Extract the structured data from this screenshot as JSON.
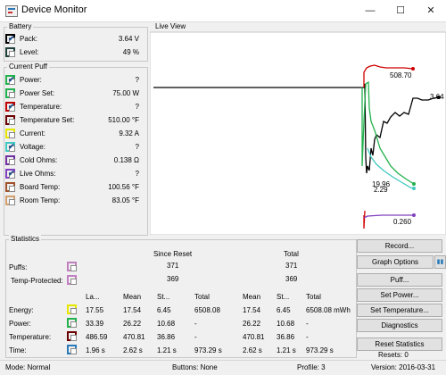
{
  "window": {
    "title": "Device Monitor",
    "minimize": "—",
    "maximize": "☐",
    "close": "✕"
  },
  "battery": {
    "group_label": "Battery",
    "rows": [
      {
        "label": "Pack:",
        "value": "3.64 V",
        "color": "#000000",
        "checked": true
      },
      {
        "label": "Level:",
        "value": "49 %",
        "color": "#1f3f3a",
        "checked": false
      }
    ]
  },
  "current_puff": {
    "group_label": "Current Puff",
    "rows": [
      {
        "label": "Power:",
        "value": "?",
        "color": "#22b14c",
        "checked": true
      },
      {
        "label": "Power Set:",
        "value": "75.00 W",
        "color": "#22b14c",
        "checked": false
      },
      {
        "label": "Temperature:",
        "value": "?",
        "color": "#c00000",
        "checked": true
      },
      {
        "label": "Temperature Set:",
        "value": "510.00 °F",
        "color": "#6b0000",
        "checked": false
      },
      {
        "label": "Current:",
        "value": "9.32 A",
        "color": "#e6e600",
        "checked": false
      },
      {
        "label": "Voltage:",
        "value": "?",
        "color": "#40c8c0",
        "checked": true
      },
      {
        "label": "Cold Ohms:",
        "value": "0.138 Ω",
        "color": "#7030a0",
        "checked": false
      },
      {
        "label": "Live Ohms:",
        "value": "?",
        "color": "#8040c0",
        "checked": true
      },
      {
        "label": "Board Temp:",
        "value": "100.56 °F",
        "color": "#a0522d",
        "checked": false
      },
      {
        "label": "Room Temp:",
        "value": "83.05 °F",
        "color": "#d2a070",
        "checked": false
      }
    ]
  },
  "live_view": {
    "group_label": "Live View",
    "annotations": [
      "508.70",
      "3.64",
      "19.96",
      "2.29",
      "0.260"
    ]
  },
  "buttons": {
    "record": "Record...",
    "graph_options": "Graph Options",
    "pause": "▮▮",
    "puff": "Puff...",
    "set_power": "Set Power...",
    "set_temperature": "Set Temperature...",
    "diagnostics": "Diagnostics",
    "reset_statistics": "Reset Statistics"
  },
  "resets": "Resets: 0",
  "statistics": {
    "group_label": "Statistics",
    "since_reset": "Since Reset",
    "total": "Total",
    "puffs_label": "Puffs:",
    "temp_protected_label": "Temp-Protected:",
    "puffs_since": "371",
    "puffs_total": "371",
    "tp_since": "369",
    "tp_total": "369",
    "headers": [
      "La...",
      "Mean",
      "St...",
      "Total",
      "Mean",
      "St...",
      "Total"
    ],
    "rows": [
      {
        "label": "Energy:",
        "color": "#e6e600",
        "cells": [
          "17.55",
          "17.54",
          "6.45",
          "6508.08",
          "17.54",
          "6.45",
          "6508.08 mWh"
        ]
      },
      {
        "label": "Power:",
        "color": "#22b14c",
        "cells": [
          "33.39",
          "26.22",
          "10.68",
          "-",
          "26.22",
          "10.68",
          "-"
        ]
      },
      {
        "label": "Temperature:",
        "color": "#6b0000",
        "cells": [
          "486.59",
          "470.81",
          "36.86",
          "-",
          "470.81",
          "36.86",
          "-"
        ]
      },
      {
        "label": "Time:",
        "color": "#2a7ab8",
        "cells": [
          "1.96 s",
          "2.62 s",
          "1.21 s",
          "973.29 s",
          "2.62 s",
          "1.21 s",
          "973.29 s"
        ]
      }
    ]
  },
  "status": {
    "mode": "Mode: Normal",
    "buttons": "Buttons: None",
    "profile": "Profile: 3",
    "version": "Version: 2016-03-31"
  }
}
